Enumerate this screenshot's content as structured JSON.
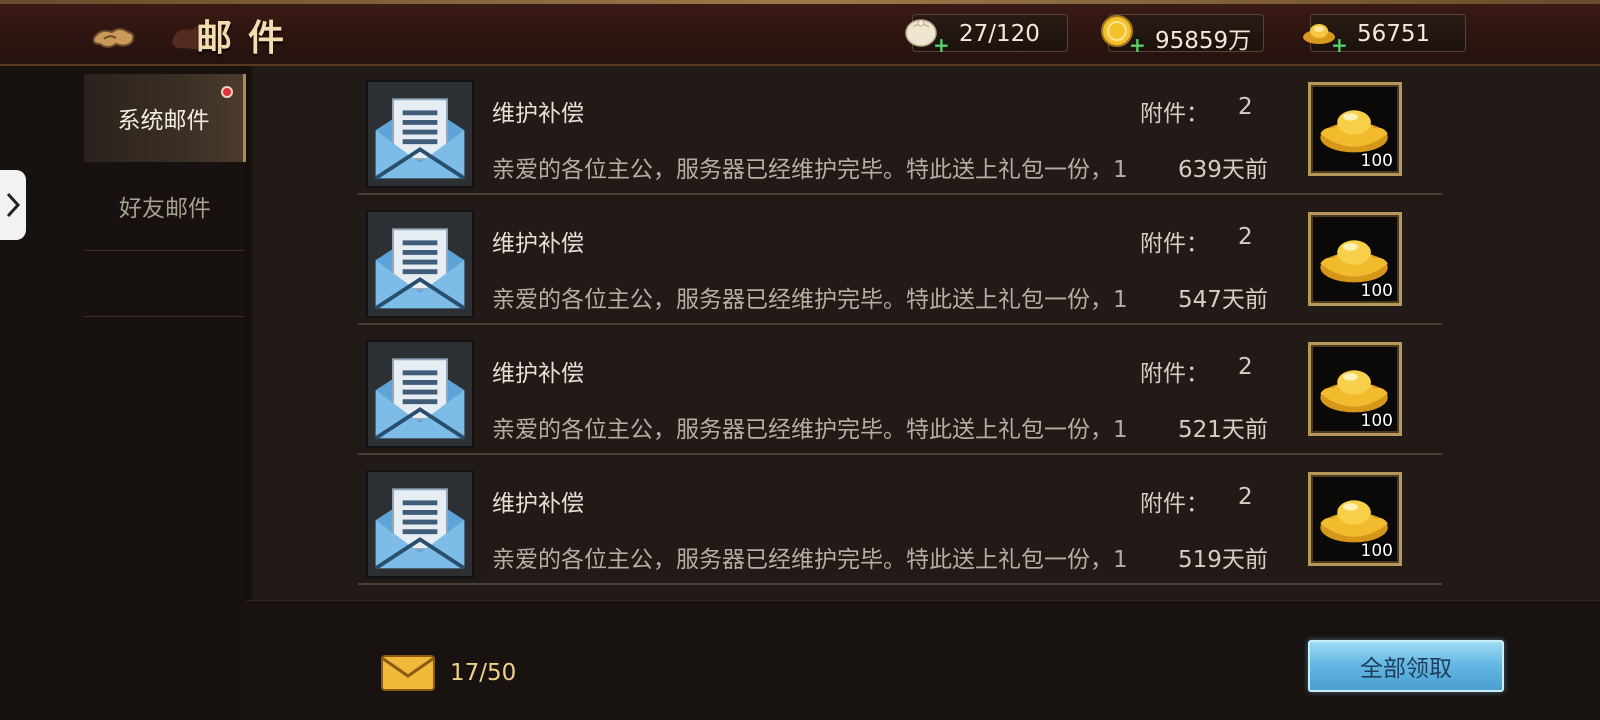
{
  "header": {
    "title": "邮件",
    "resources": [
      {
        "name": "stamina",
        "icon": "steamed-bun-icon",
        "value": "27/120"
      },
      {
        "name": "coins",
        "icon": "gold-coin-icon",
        "value": "95859万"
      },
      {
        "name": "ingots",
        "icon": "gold-ingot-icon",
        "value": "56751"
      }
    ]
  },
  "sidebar": {
    "tabs": [
      {
        "label": "系统邮件",
        "active": true,
        "has_notification": true
      },
      {
        "label": "好友邮件",
        "active": false
      }
    ]
  },
  "mails": [
    {
      "title": "维护补偿",
      "attach_label": "附件：",
      "attach_count": "2",
      "preview": "亲爱的各位主公，服务器已经维护完毕。特此送上礼包一份，1",
      "time_ago": "639天前",
      "reward_qty": "100",
      "reward_icon": "gold-ingot-icon"
    },
    {
      "title": "维护补偿",
      "attach_label": "附件：",
      "attach_count": "2",
      "preview": "亲爱的各位主公，服务器已经维护完毕。特此送上礼包一份，1",
      "time_ago": "547天前",
      "reward_qty": "100",
      "reward_icon": "gold-ingot-icon"
    },
    {
      "title": "维护补偿",
      "attach_label": "附件：",
      "attach_count": "2",
      "preview": "亲爱的各位主公，服务器已经维护完毕。特此送上礼包一份，1",
      "time_ago": "521天前",
      "reward_qty": "100",
      "reward_icon": "gold-ingot-icon"
    },
    {
      "title": "维护补偿",
      "attach_label": "附件：",
      "attach_count": "2",
      "preview": "亲爱的各位主公，服务器已经维护完毕。特此送上礼包一份，1",
      "time_ago": "519天前",
      "reward_qty": "100",
      "reward_icon": "gold-ingot-icon"
    }
  ],
  "footer": {
    "mail_count": "17/50",
    "claim_all_label": "全部领取"
  },
  "colors": {
    "accent_gold": "#b8975a",
    "claim_button": "#66b9e4",
    "notification_dot": "#e2333a"
  }
}
